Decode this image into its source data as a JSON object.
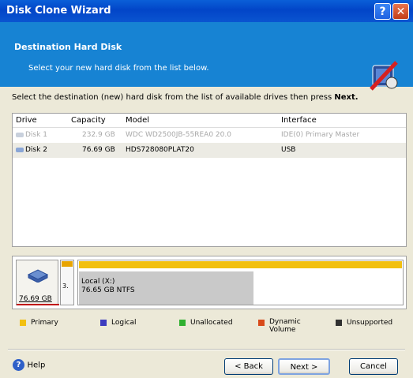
{
  "window": {
    "title": "Disk Clone Wizard",
    "help_glyph": "?",
    "close_glyph": "✕"
  },
  "header": {
    "title": "Destination Hard Disk",
    "subtitle": "Select your new hard disk from the list below."
  },
  "instruction": {
    "text": "Select the destination (new) hard disk from the list of available drives then press",
    "bold": "Next."
  },
  "table": {
    "columns": [
      "Drive",
      "Capacity",
      "Model",
      "Interface"
    ],
    "rows": [
      {
        "drive": "Disk 1",
        "capacity": "232.9 GB",
        "model": "WDC WD2500JB-55REA0 20.0",
        "interface": "IDE(0) Primary Master",
        "disabled": true
      },
      {
        "drive": "Disk 2",
        "capacity": "76.69 GB",
        "model": "HDS728080PLAT20",
        "interface": "USB",
        "selected": true
      }
    ]
  },
  "disk_map": {
    "disk_size": "76.69 GB",
    "small_partition_label": "3.",
    "partition_name": "Local (X:)",
    "partition_info": "76.65 GB  NTFS",
    "used_fraction": 0.54
  },
  "legend": [
    {
      "label": "Primary",
      "color": "#f2c010"
    },
    {
      "label": "Logical",
      "color": "#3c3cbf"
    },
    {
      "label": "Unallocated",
      "color": "#30b030"
    },
    {
      "label": "Dynamic Volume",
      "color": "#d84a1a"
    },
    {
      "label": "Unsupported",
      "color": "#303030"
    }
  ],
  "buttons": {
    "help": "Help",
    "back": "< Back",
    "next": "Next >",
    "cancel": "Cancel"
  }
}
